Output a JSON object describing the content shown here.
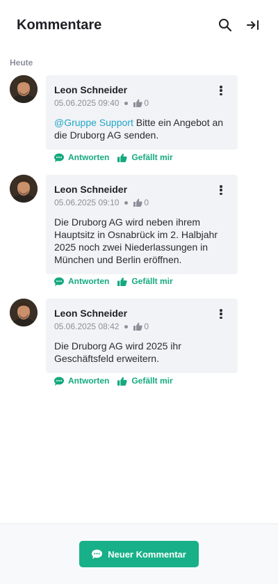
{
  "header": {
    "title": "Kommentare",
    "search_icon": "search-icon",
    "collapse_icon": "arrow-right-to-line-icon"
  },
  "section": {
    "label": "Heute"
  },
  "comments": [
    {
      "author": "Leon Schneider",
      "timestamp": "05.06.2025 09:40",
      "likes": "0",
      "mention": "@Gruppe Support",
      "text": " Bitte ein Angebot an die Druborg AG senden."
    },
    {
      "author": "Leon Schneider",
      "timestamp": "05.06.2025 09:10",
      "likes": "0",
      "mention": "",
      "text": "Die Druborg AG wird neben ihrem Hauptsitz in Osnabrück im 2. Halbjahr 2025 noch zwei Niederlassungen in München und Berlin eröffnen."
    },
    {
      "author": "Leon Schneider",
      "timestamp": "05.06.2025 08:42",
      "likes": "0",
      "mention": "",
      "text": "Die Druborg AG wird 2025 ihr Geschäftsfeld erweitern."
    }
  ],
  "actions": {
    "reply_label": "Antworten",
    "like_label": "Gefällt mir"
  },
  "footer": {
    "new_comment_label": "Neuer Kommentar"
  },
  "colors": {
    "accent": "#17b088",
    "mention": "#1fa6c9",
    "bubble_bg": "#f2f3f6"
  }
}
